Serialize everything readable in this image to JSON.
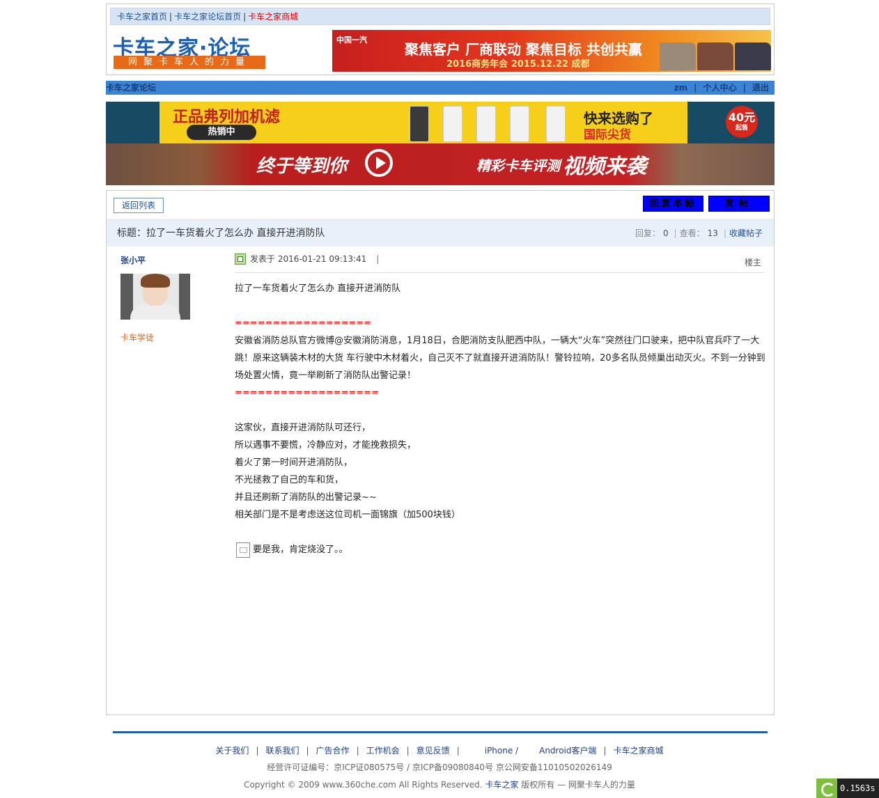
{
  "top_nav": {
    "links": [
      "卡车之家首页",
      "卡车之家论坛首页",
      "卡车之家商城"
    ],
    "separator": "|"
  },
  "logo": {
    "title": "卡车之家·论坛",
    "slogan": "网聚卡车人的力量"
  },
  "banner_top": {
    "brand": "中国一汽",
    "text": "聚焦客户 厂商联动 聚焦目标 共创共赢",
    "subtext": "2016商务年会 2015.12.22 成都"
  },
  "forum_bar": {
    "name": "卡车之家论坛",
    "user": "zm",
    "personal_center": "个人中心",
    "logout": "退出",
    "separator": "|"
  },
  "ad_filters": {
    "headline": "正品弗列加机滤",
    "badge": "热销中",
    "right_line1": "快来选购了",
    "right_line2": "国际尖货",
    "price": "40元",
    "price_note": "起售"
  },
  "ad_video": {
    "text1": "终于等到你",
    "text2": "精彩卡车评测",
    "text3": "视频来袭"
  },
  "actions": {
    "back": "返回列表",
    "reply": "回复本帖",
    "new_post": "发帖"
  },
  "thread": {
    "title_label": "标题：",
    "title": "拉了一车货着火了怎么办 直接开进消防队",
    "reply_label": "回复：",
    "reply_count": "0",
    "view_label": "查看：",
    "view_count": "13",
    "favorite": "收藏帖子",
    "separator": "|"
  },
  "author": {
    "name": "张小平",
    "rank": "卡车学徒"
  },
  "post": {
    "meta": "发表于 2016-01-21 09:13:41",
    "meta_sep": "|",
    "floor": "楼主",
    "lines": [
      "拉了一车货着火了怎么办 直接开进消防队",
      "",
      "==================",
      "安徽省消防总队官方微博@安徽消防消息，1月18日，合肥消防支队肥西中队，一辆大“火车”突然往门口驶来，把中队官兵吓了一大跳！原来这辆装木材的大货 车行驶中木材着火，自己灭不了就直接开进消防队！警铃拉响，20多名队员倾巢出动灭火。不到一分钟到场处置火情，竟一举刷新了消防队出警记录！",
      "===================",
      "",
      "这家伙，直接开进消防队可还行，",
      "所以遇事不要慌，冷静应对，才能挽救损失，",
      "着火了第一时间开进消防队，",
      "不光拯救了自己的车和货，",
      "并且还刷新了消防队的出警记录~~",
      "相关部门是不是考虑送这位司机一面锦旗（加500块钱）",
      "",
      "要是我，肯定烧没了。。"
    ]
  },
  "footer": {
    "links": [
      "关于我们",
      "联系我们",
      "广告合作",
      "工作机会",
      "意见反馈",
      "iPhone /",
      "Android客户端",
      "卡车之家商城"
    ],
    "license": "经营许可证编号：京ICP证080575号 / 京ICP备09080840号 京公网安备11010502026149",
    "copyright_pre": "Copyright © 2009 www.360che.com All Rights Reserved.",
    "brand": "卡车之家",
    "copyright_post": "版权所有 — 网聚卡车人的力量"
  },
  "timer": "0.1563s"
}
